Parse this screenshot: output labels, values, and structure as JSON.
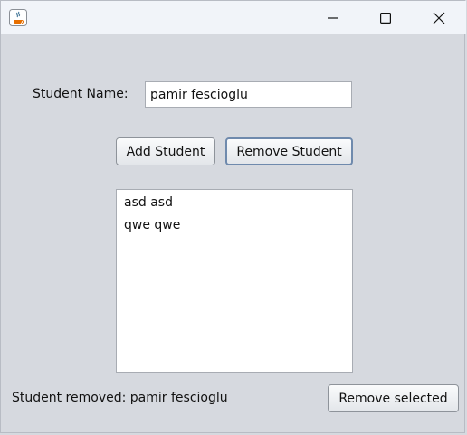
{
  "window": {
    "title": "",
    "controls": {
      "minimize": "minimize",
      "maximize": "maximize",
      "close": "close"
    }
  },
  "form": {
    "name_label": "Student Name:",
    "name_value": "pamir fescioglu"
  },
  "buttons": {
    "add": "Add Student",
    "remove": "Remove Student",
    "remove_selected": "Remove selected"
  },
  "list": {
    "items": [
      "asd asd",
      "qwe qwe"
    ]
  },
  "status": {
    "message": "Student removed: pamir fescioglu"
  },
  "colors": {
    "window_bg": "#d6d9df",
    "titlebar_bg": "#f1f4f9",
    "focus_border": "#6f8aad"
  }
}
